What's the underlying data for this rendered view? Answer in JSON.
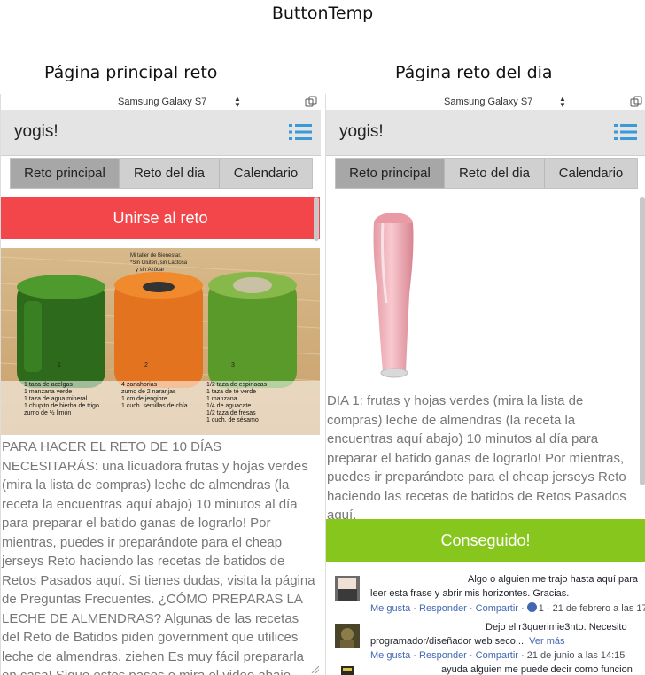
{
  "page_title": "ButtonTemp",
  "left": {
    "caption": "Página principal reto",
    "device": "Samsung Galaxy S7",
    "app_title": "yogis!",
    "tabs": [
      "Reto principal",
      "Reto del dia",
      "Calendario"
    ],
    "active_tab": "Reto principal",
    "join_button": "Unirse al reto",
    "image_texts": {
      "note_1": "Mi taller de Bienestar.",
      "note_2": "*Sin Gluten, sin Lactosa",
      "note_3": "y sin Azúcar",
      "num_1": "1",
      "num_2": "2",
      "num_3": "3",
      "recipe_1": [
        "1 taza de acelgas",
        "1 manzana verde",
        "1 taza de agua mineral",
        "1 chupito de hierba de trigo",
        "zumo de ½ limón"
      ],
      "recipe_2": [
        "4 zanahorias",
        "zumo de 2 naranjas",
        "1 cm de jengibre",
        "1 cuch. semillas de chía"
      ],
      "recipe_3": [
        "1/2 taza de espinacas",
        "1 taza de té verde",
        "1 manzana",
        "1/4 de aguacate",
        "1/2 taza de fresas",
        "1 cuch. de sésamo"
      ]
    },
    "body_text": "PARA HACER EL RETO DE 10 DÍAS NECESITARÁS: una licuadora frutas y hojas verdes (mira la lista de compras) leche de almendras (la receta la encuentras aquí abajo) 10 minutos al día para preparar el batido ganas de lograrlo! Por mientras, puedes ir preparándote para el cheap jerseys Reto haciendo las recetas de batidos de Retos Pasados aquí. Si tienes dudas, visita la página de Preguntas Frecuentes. ¿CÓMO PREPARAS LA LECHE DE ALMENDRAS? Algunas de las recetas del Reto de Batidos piden government que utilices leche de almendras. ziehen Es muy fácil prepararla en casa! Sigue estos pasos o mira el video abajo para las"
  },
  "right": {
    "caption": "Página reto del dia",
    "device": "Samsung Galaxy S7",
    "app_title": "yogis!",
    "tabs": [
      "Reto principal",
      "Reto del dia",
      "Calendario"
    ],
    "active_tab": "Reto principal",
    "body_text": "DIA 1: frutas y hojas verdes (mira la lista de compras) leche de almendras (la receta la encuentras aquí abajo) 10 minutos al día para preparar el batido ganas de lograrlo! Por mientras, puedes ir preparándote para el cheap jerseys Reto haciendo las recetas de batidos de Retos Pasados aquí.",
    "done_button": "Conseguido!",
    "comments": [
      {
        "text": "Algo o alguien me trajo hasta aquí para leer esta frase y abrir mis horizontes. Gracias.",
        "actions": [
          "Me gusta",
          "Responder",
          "Compartir"
        ],
        "likes": "1",
        "date": "21 de febrero a las 17"
      },
      {
        "text": "Dejo el r3querimie3nto. Necesito programador/diseñador web seco....",
        "more": "Ver más",
        "actions": [
          "Me gusta",
          "Responder",
          "Compartir"
        ],
        "date": "21 de junio a las 14:15"
      },
      {
        "text": "ayuda   alguien me puede decir como funcion"
      }
    ]
  },
  "colors": {
    "join_button": "#f3464a",
    "done_button": "#87c61c",
    "header_bg": "#e4e4e4",
    "tab_active": "#a7a7a7",
    "menu_icon": "#3a9ad9",
    "link": "#4267b2"
  }
}
